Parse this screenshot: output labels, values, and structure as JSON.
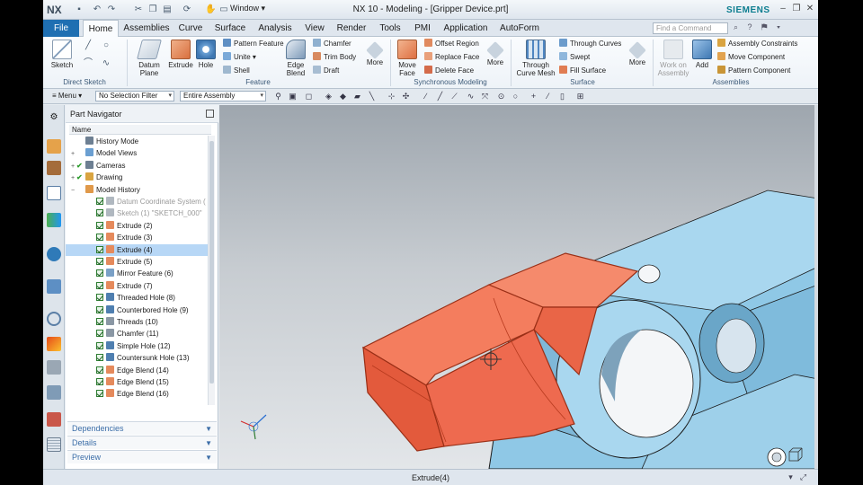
{
  "titlebar": {
    "logo": "NX",
    "window_menu": "Window",
    "title": "NX 10 - Modeling - [Gripper Device.prt]",
    "brand": "SIEMENS"
  },
  "ribbon_tabs": [
    "File",
    "Home",
    "Assemblies",
    "Curve",
    "Surface",
    "Analysis",
    "View",
    "Render",
    "Tools",
    "PMI",
    "Application",
    "AutoForm"
  ],
  "active_tab": "Home",
  "search": {
    "placeholder": "Find a Command"
  },
  "ribbon": {
    "direct_sketch": {
      "label": "Direct Sketch",
      "sketch": "Sketch"
    },
    "feature": {
      "label": "Feature",
      "datum_plane": "Datum Plane",
      "extrude": "Extrude",
      "hole": "Hole",
      "pattern_feature": "Pattern Feature",
      "unite": "Unite",
      "shell": "Shell",
      "edge_blend": "Edge Blend",
      "chamfer": "Chamfer",
      "trim_body": "Trim Body",
      "draft": "Draft",
      "more": "More"
    },
    "synchronous": {
      "label": "Synchronous Modeling",
      "move_face": "Move Face",
      "offset_region": "Offset Region",
      "replace_face": "Replace Face",
      "delete_face": "Delete Face",
      "more": "More"
    },
    "surface": {
      "label": "Surface",
      "through_curve_mesh": "Through Curve Mesh",
      "through_curves": "Through Curves",
      "swept": "Swept",
      "fill_surface": "Fill Surface",
      "more": "More"
    },
    "assemblies": {
      "label": "Assemblies",
      "work_on_assembly": "Work on Assembly",
      "add": "Add",
      "assembly_constraints": "Assembly Constraints",
      "move_component": "Move Component",
      "pattern_component": "Pattern Component"
    }
  },
  "selection_bar": {
    "menu": "Menu",
    "filter": "No Selection Filter",
    "scope": "Entire Assembly"
  },
  "part_navigator": {
    "title": "Part Navigator",
    "column": "Name",
    "rows": [
      {
        "label": "History Mode",
        "level": 1,
        "icon": "clock-icon",
        "check": ""
      },
      {
        "label": "Model Views",
        "level": 1,
        "icon": "views-icon",
        "check": "",
        "expand": "+"
      },
      {
        "label": "Cameras",
        "level": 1,
        "icon": "camera-icon",
        "check": "✔",
        "expand": "+"
      },
      {
        "label": "Drawing",
        "level": 1,
        "icon": "drawing-icon",
        "check": "✔",
        "expand": "+"
      },
      {
        "label": "Model History",
        "level": 1,
        "icon": "folder-icon",
        "check": "",
        "expand": "−"
      },
      {
        "label": "Datum Coordinate System (",
        "level": 2,
        "icon": "datum-icon",
        "dim": true
      },
      {
        "label": "Sketch (1) \"SKETCH_000\"",
        "level": 2,
        "icon": "sketch-icon",
        "dim": true
      },
      {
        "label": "Extrude (2)",
        "level": 2,
        "icon": "extrude-icon"
      },
      {
        "label": "Extrude (3)",
        "level": 2,
        "icon": "extrude-icon"
      },
      {
        "label": "Extrude (4)",
        "level": 2,
        "icon": "extrude-icon",
        "selected": true
      },
      {
        "label": "Extrude (5)",
        "level": 2,
        "icon": "extrude-icon"
      },
      {
        "label": "Mirror Feature (6)",
        "level": 2,
        "icon": "mirror-icon"
      },
      {
        "label": "Extrude (7)",
        "level": 2,
        "icon": "extrude-icon"
      },
      {
        "label": "Threaded Hole (8)",
        "level": 2,
        "icon": "hole-icon"
      },
      {
        "label": "Counterbored Hole (9)",
        "level": 2,
        "icon": "hole-icon"
      },
      {
        "label": "Threads (10)",
        "level": 2,
        "icon": "threads-icon"
      },
      {
        "label": "Chamfer (11)",
        "level": 2,
        "icon": "chamfer-icon"
      },
      {
        "label": "Simple Hole (12)",
        "level": 2,
        "icon": "hole-icon"
      },
      {
        "label": "Countersunk Hole (13)",
        "level": 2,
        "icon": "hole-icon"
      },
      {
        "label": "Edge Blend (14)",
        "level": 2,
        "icon": "blend-icon"
      },
      {
        "label": "Edge Blend (15)",
        "level": 2,
        "icon": "blend-icon"
      },
      {
        "label": "Edge Blend (16)",
        "level": 2,
        "icon": "blend-icon"
      }
    ],
    "sections": [
      "Dependencies",
      "Details",
      "Preview"
    ]
  },
  "status": {
    "text": "Extrude(4)"
  },
  "colors": {
    "file_tab": "#1f6fb2",
    "selection": "#b7d7f6",
    "highlight_part": "#ee6a4f",
    "model_body": "#8fc8e6",
    "brand": "#0b7d8f"
  }
}
